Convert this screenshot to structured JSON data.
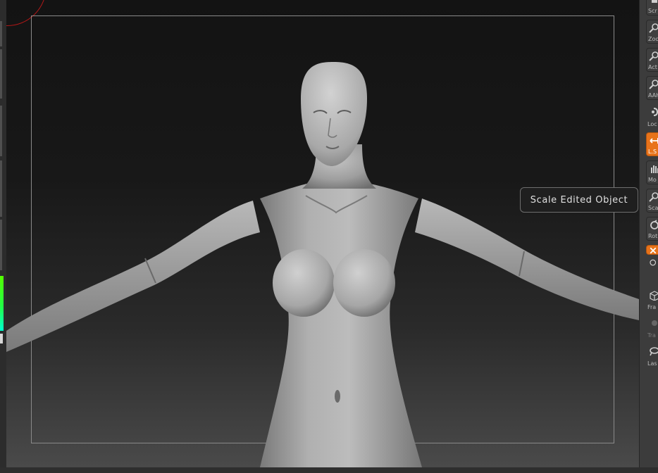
{
  "tooltip": {
    "text": "Scale Edited Object"
  },
  "right_shelf": {
    "buttons": [
      {
        "label": "Scr",
        "icon": "scroll-icon"
      },
      {
        "label": "Zoo",
        "icon": "zoom-icon"
      },
      {
        "label": "Act",
        "icon": "actual-icon"
      },
      {
        "label": "AAH",
        "icon": "aahalf-icon"
      },
      {
        "label": "Loc",
        "icon": "local-icon"
      },
      {
        "label": "L.S",
        "icon": "local-symmetry-icon",
        "active": true
      },
      {
        "label": "Mo",
        "icon": "move-hand-icon"
      },
      {
        "label": "Sca",
        "icon": "scale-icon"
      },
      {
        "label": "Rot",
        "icon": "rotate-icon"
      },
      {
        "label": "",
        "icon": "xyz-icon",
        "active": true
      },
      {
        "label": "Fra",
        "icon": "frame-icon"
      },
      {
        "label": "Tra",
        "icon": "transp-icon"
      },
      {
        "label": "Las",
        "icon": "lasso-icon"
      }
    ]
  },
  "colors": {
    "accent": "#e8731a",
    "gizmo": "#b01818",
    "frame": "#8a8a8a"
  }
}
